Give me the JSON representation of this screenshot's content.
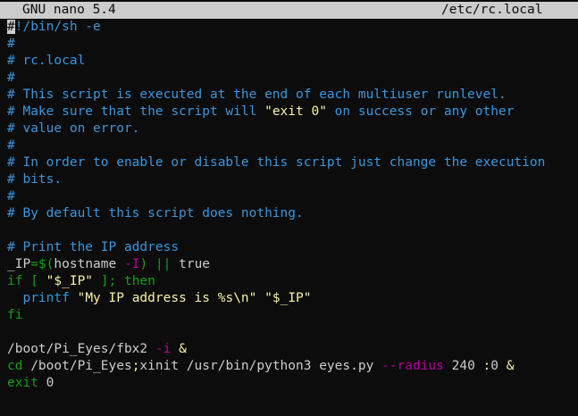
{
  "titlebar": {
    "app": "GNU nano 5.4",
    "file": "/etc/rc.local"
  },
  "colors": {
    "comment": "#3a96dd",
    "string": "#f9f1a5",
    "keyword": "#13a10e",
    "option": "#b4009e",
    "text": "#cccccc",
    "background": "#0c0c0c"
  },
  "editor": {
    "lines": [
      [
        {
          "t": "#",
          "c": "cursor"
        },
        {
          "t": "!/bin/sh -e",
          "c": "comment"
        }
      ],
      [
        {
          "t": "#",
          "c": "comment"
        }
      ],
      [
        {
          "t": "# rc.local",
          "c": "comment"
        }
      ],
      [
        {
          "t": "#",
          "c": "comment"
        }
      ],
      [
        {
          "t": "# This script is executed at the end of each multiuser runlevel.",
          "c": "comment"
        }
      ],
      [
        {
          "t": "# Make sure that the script will ",
          "c": "comment"
        },
        {
          "t": "\"exit 0\"",
          "c": "string"
        },
        {
          "t": " on success or any other",
          "c": "comment"
        }
      ],
      [
        {
          "t": "# value on error.",
          "c": "comment"
        }
      ],
      [
        {
          "t": "#",
          "c": "comment"
        }
      ],
      [
        {
          "t": "# In order to enable or disable this script just change the execution",
          "c": "comment"
        }
      ],
      [
        {
          "t": "# bits.",
          "c": "comment"
        }
      ],
      [
        {
          "t": "#",
          "c": "comment"
        }
      ],
      [
        {
          "t": "# By default this script does nothing.",
          "c": "comment"
        }
      ],
      [],
      [
        {
          "t": "# Print the IP address",
          "c": "comment"
        }
      ],
      [
        {
          "t": "_IP",
          "c": "text"
        },
        {
          "t": "=$(",
          "c": "keyword"
        },
        {
          "t": "hostname ",
          "c": "text"
        },
        {
          "t": "-I",
          "c": "option"
        },
        {
          "t": ") || ",
          "c": "keyword"
        },
        {
          "t": "true",
          "c": "text"
        }
      ],
      [
        {
          "t": "if [ ",
          "c": "keyword"
        },
        {
          "t": "\"$_IP\"",
          "c": "string"
        },
        {
          "t": " ]; then",
          "c": "keyword"
        }
      ],
      [
        {
          "t": "  ",
          "c": "text"
        },
        {
          "t": "printf",
          "c": "func"
        },
        {
          "t": " ",
          "c": "text"
        },
        {
          "t": "\"My IP address is %s\\n\"",
          "c": "string"
        },
        {
          "t": " ",
          "c": "text"
        },
        {
          "t": "\"$_IP\"",
          "c": "string"
        }
      ],
      [
        {
          "t": "fi",
          "c": "keyword"
        }
      ],
      [],
      [
        {
          "t": "/boot/Pi_Eyes/fbx2 ",
          "c": "text"
        },
        {
          "t": "-i",
          "c": "option"
        },
        {
          "t": " &",
          "c": "string"
        }
      ],
      [
        {
          "t": "cd",
          "c": "keyword"
        },
        {
          "t": " /boot/Pi_Eyes",
          "c": "text"
        },
        {
          "t": ";",
          "c": "string"
        },
        {
          "t": "xinit /usr/bin/python3 eyes.py ",
          "c": "text"
        },
        {
          "t": "--radius",
          "c": "option"
        },
        {
          "t": " 240 ",
          "c": "text"
        },
        {
          "t": ":",
          "c": "string"
        },
        {
          "t": "0 ",
          "c": "text"
        },
        {
          "t": "&",
          "c": "string"
        }
      ],
      [
        {
          "t": "exit",
          "c": "keyword"
        },
        {
          "t": " 0",
          "c": "text"
        }
      ]
    ]
  }
}
